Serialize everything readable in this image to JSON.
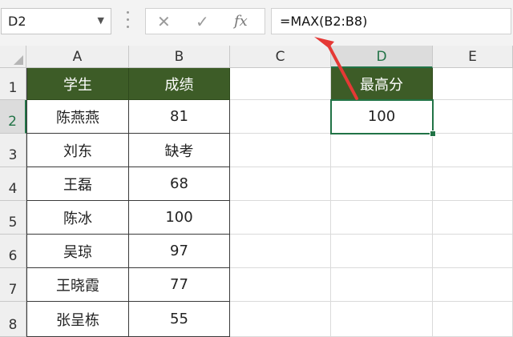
{
  "name_box": {
    "value": "D2",
    "dropdown_icon": "chevron-down-icon"
  },
  "formula_buttons": {
    "cancel_glyph": "✕",
    "enter_glyph": "✓",
    "fx_glyph": "fx"
  },
  "formula_bar": {
    "value": "=MAX(B2:B8)"
  },
  "columns": [
    "A",
    "B",
    "C",
    "D",
    "E"
  ],
  "rows": [
    "1",
    "2",
    "3",
    "4",
    "5",
    "6",
    "7",
    "8"
  ],
  "table": {
    "headers": [
      "学生",
      "成绩"
    ],
    "rows": [
      [
        "陈燕燕",
        "81"
      ],
      [
        "刘东",
        "缺考"
      ],
      [
        "王磊",
        "68"
      ],
      [
        "陈冰",
        "100"
      ],
      [
        "吴琼",
        "97"
      ],
      [
        "王晓霞",
        "77"
      ],
      [
        "张呈栋",
        "55"
      ]
    ]
  },
  "result": {
    "header": "最高分",
    "value": "100"
  },
  "colors": {
    "header_fill": "#3d5c27",
    "accent": "#217346",
    "arrow": "#e53935"
  }
}
